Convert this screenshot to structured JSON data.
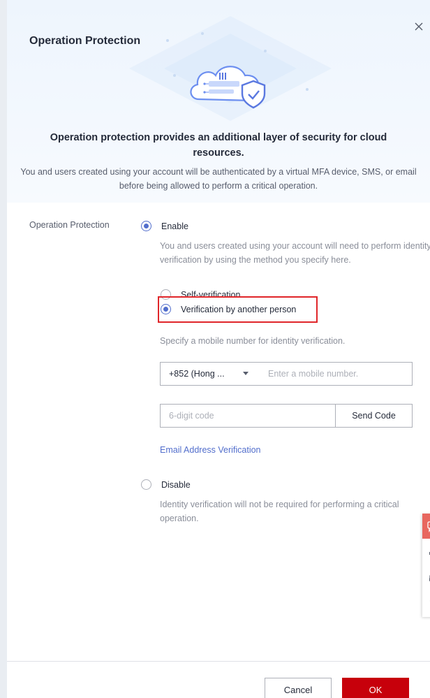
{
  "dialog": {
    "title": "Operation Protection",
    "headline": "Operation protection provides an additional layer of security for cloud resources.",
    "description": "You and users created using your account will be authenticated by a virtual MFA device, SMS, or email before being allowed to perform a critical operation."
  },
  "form": {
    "field_label": "Operation Protection",
    "enable": {
      "label": "Enable",
      "selected": true,
      "hint": "You and users created using your account will need to perform identity verification by using the method you specify here."
    },
    "verification_methods": [
      {
        "label": "Self-verification",
        "selected": false
      },
      {
        "label": "Verification by another person",
        "selected": true
      }
    ],
    "mobile_hint": "Specify a mobile number for identity verification.",
    "country_code": "+852 (Hong ...",
    "mobile_placeholder": "Enter a mobile number.",
    "code_placeholder": "6-digit code",
    "send_code_label": "Send Code",
    "email_link": "Email Address Verification",
    "disable": {
      "label": "Disable",
      "selected": false,
      "hint": "Identity verification will not be required for performing a critical operation."
    }
  },
  "footer": {
    "cancel_label": "Cancel",
    "ok_label": "OK"
  },
  "colors": {
    "brand_red": "#c7000b",
    "radio_blue": "#526ecc",
    "highlight_red": "#e0262a",
    "link_blue": "#526ecc"
  },
  "icons": {
    "close": "close-icon",
    "illustration": "cloud-shield-illustration",
    "float_bar": [
      "chat-icon",
      "speaker-icon",
      "headset-icon",
      "help-icon"
    ]
  }
}
